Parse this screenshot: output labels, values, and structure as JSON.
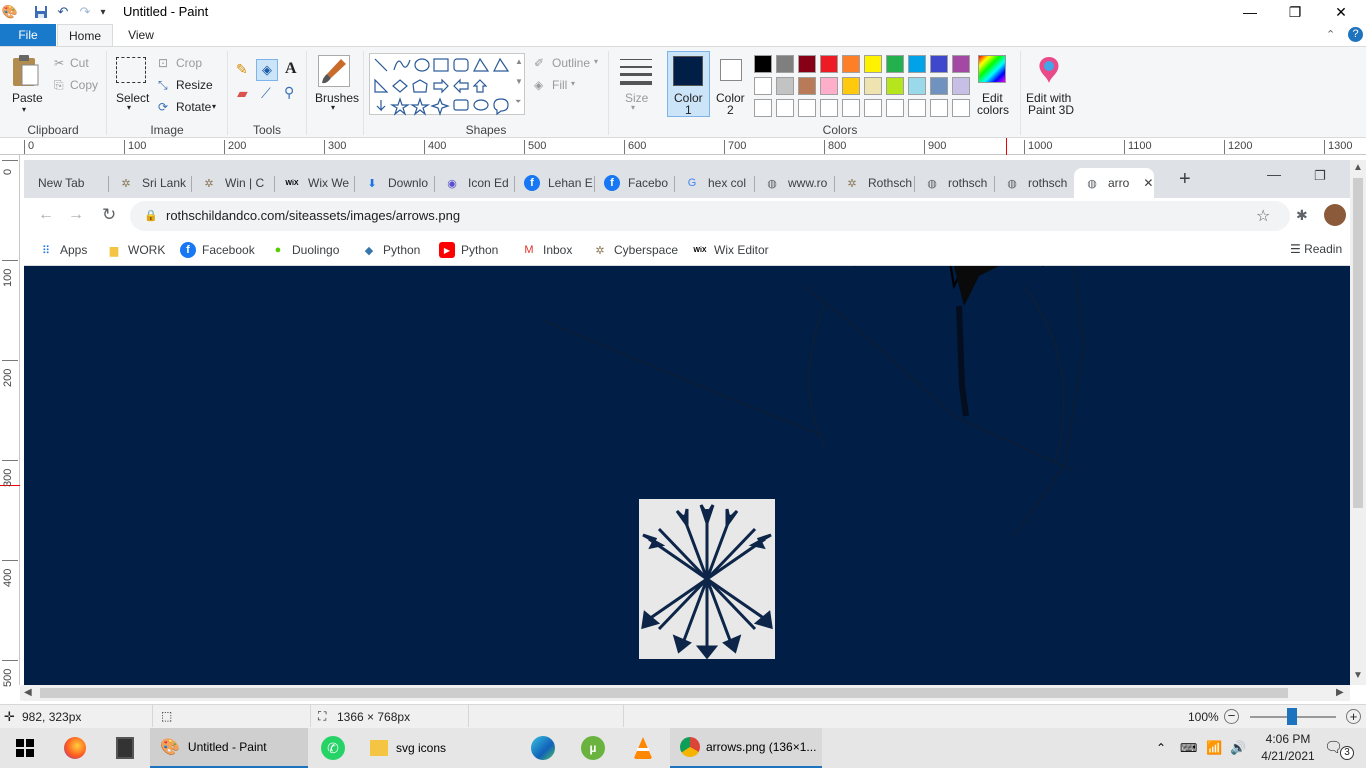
{
  "window": {
    "title": "Untitled - Paint",
    "minimize": "—",
    "restore": "❐",
    "close": "✕"
  },
  "ribbon_tabs": [
    "File",
    "Home",
    "View"
  ],
  "ribbon": {
    "clipboard": {
      "paste": "Paste",
      "cut": "Cut",
      "copy": "Copy",
      "label": "Clipboard"
    },
    "image": {
      "select": "Select",
      "crop": "Crop",
      "resize": "Resize",
      "rotate": "Rotate",
      "label": "Image"
    },
    "tools": {
      "label": "Tools"
    },
    "brushes": "Brushes",
    "shapes": {
      "outline": "Outline",
      "fill": "Fill",
      "label": "Shapes"
    },
    "size": "Size",
    "color1": [
      "Color",
      "1"
    ],
    "color2": [
      "Color",
      "2"
    ],
    "colors_label": "Colors",
    "edit_colors": [
      "Edit",
      "colors"
    ],
    "edit_3d": [
      "Edit with",
      "Paint 3D"
    ],
    "palette_row1": [
      "#000000",
      "#7f7f7f",
      "#880015",
      "#ed1c24",
      "#ff7f27",
      "#fff200",
      "#22b14c",
      "#00a2e8",
      "#3f48cc",
      "#a349a4"
    ],
    "palette_row2": [
      "#ffffff",
      "#c3c3c3",
      "#b97a57",
      "#ffaec9",
      "#ffc90e",
      "#efe4b0",
      "#b5e61d",
      "#99d9ea",
      "#7092be",
      "#c8bfe7"
    ],
    "color1_value": "#001e46",
    "color2_value": "#ffffff"
  },
  "ruler": {
    "h": [
      "0",
      "100",
      "200",
      "300",
      "400",
      "500",
      "600",
      "700",
      "800",
      "900",
      "1000",
      "1100",
      "1200",
      "1300"
    ],
    "v": [
      "0",
      "100",
      "200",
      "300",
      "400",
      "500"
    ]
  },
  "browser": {
    "tabs": [
      {
        "title": "New Tab",
        "icon": "none"
      },
      {
        "title": "Sri Lank",
        "icon": "star-logo-icon"
      },
      {
        "title": "Win | C",
        "icon": "star-logo-icon"
      },
      {
        "title": "Wix We",
        "icon": "wix-icon"
      },
      {
        "title": "Downlo",
        "icon": "download-icon"
      },
      {
        "title": "Icon Ed",
        "icon": "search-app-icon"
      },
      {
        "title": "Lehan E",
        "icon": "facebook-icon"
      },
      {
        "title": "Facebo",
        "icon": "facebook-icon"
      },
      {
        "title": "hex col",
        "icon": "google-icon"
      },
      {
        "title": "www.ro",
        "icon": "globe-icon"
      },
      {
        "title": "Rothsch",
        "icon": "star-logo-icon"
      },
      {
        "title": "rothsch",
        "icon": "globe-icon"
      },
      {
        "title": "rothsch",
        "icon": "globe-icon"
      },
      {
        "title": "arro",
        "icon": "globe-icon"
      }
    ],
    "url": "rothschildandco.com/siteassets/images/arrows.png",
    "bookmarks": [
      {
        "label": "Apps",
        "icon": "apps-grid-icon"
      },
      {
        "label": "WORK",
        "icon": "folder-icon"
      },
      {
        "label": "Facebook",
        "icon": "facebook-icon"
      },
      {
        "label": "Duolingo",
        "icon": "duolingo-icon"
      },
      {
        "label": "Python",
        "icon": "python-icon"
      },
      {
        "label": "Python",
        "icon": "youtube-icon"
      },
      {
        "label": "Inbox",
        "icon": "gmail-icon"
      },
      {
        "label": "Cyberspace",
        "icon": "star-logo-icon"
      },
      {
        "label": "Wix Editor",
        "icon": "wix-icon"
      }
    ],
    "reading_list": "Readin"
  },
  "status": {
    "cursor": "982, 323px",
    "dimensions": "1366 × 768px",
    "zoom": "100%"
  },
  "taskbar": {
    "items": [
      "Untitled - Paint",
      "svg icons",
      "arrows.png (136×1..."
    ],
    "time": "4:06 PM",
    "date": "4/21/2021",
    "notifications": "3"
  }
}
